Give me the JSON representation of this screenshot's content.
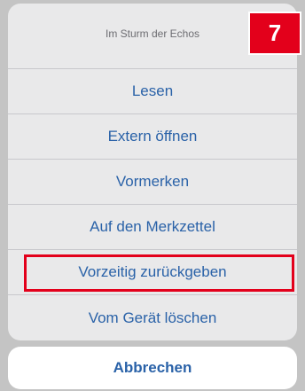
{
  "sheet": {
    "title": "Im Sturm der Echos",
    "actions": [
      {
        "label": "Lesen"
      },
      {
        "label": "Extern öffnen"
      },
      {
        "label": "Vormerken"
      },
      {
        "label": "Auf den Merkzettel"
      },
      {
        "label": "Vorzeitig zurückgeben"
      },
      {
        "label": "Vom Gerät löschen"
      }
    ],
    "cancel_label": "Abbrechen"
  },
  "annotation": {
    "step_number": "7",
    "highlight_color": "#e3001b"
  },
  "colors": {
    "action_text": "#2a62a8",
    "sheet_background": "#e9e9ea"
  }
}
